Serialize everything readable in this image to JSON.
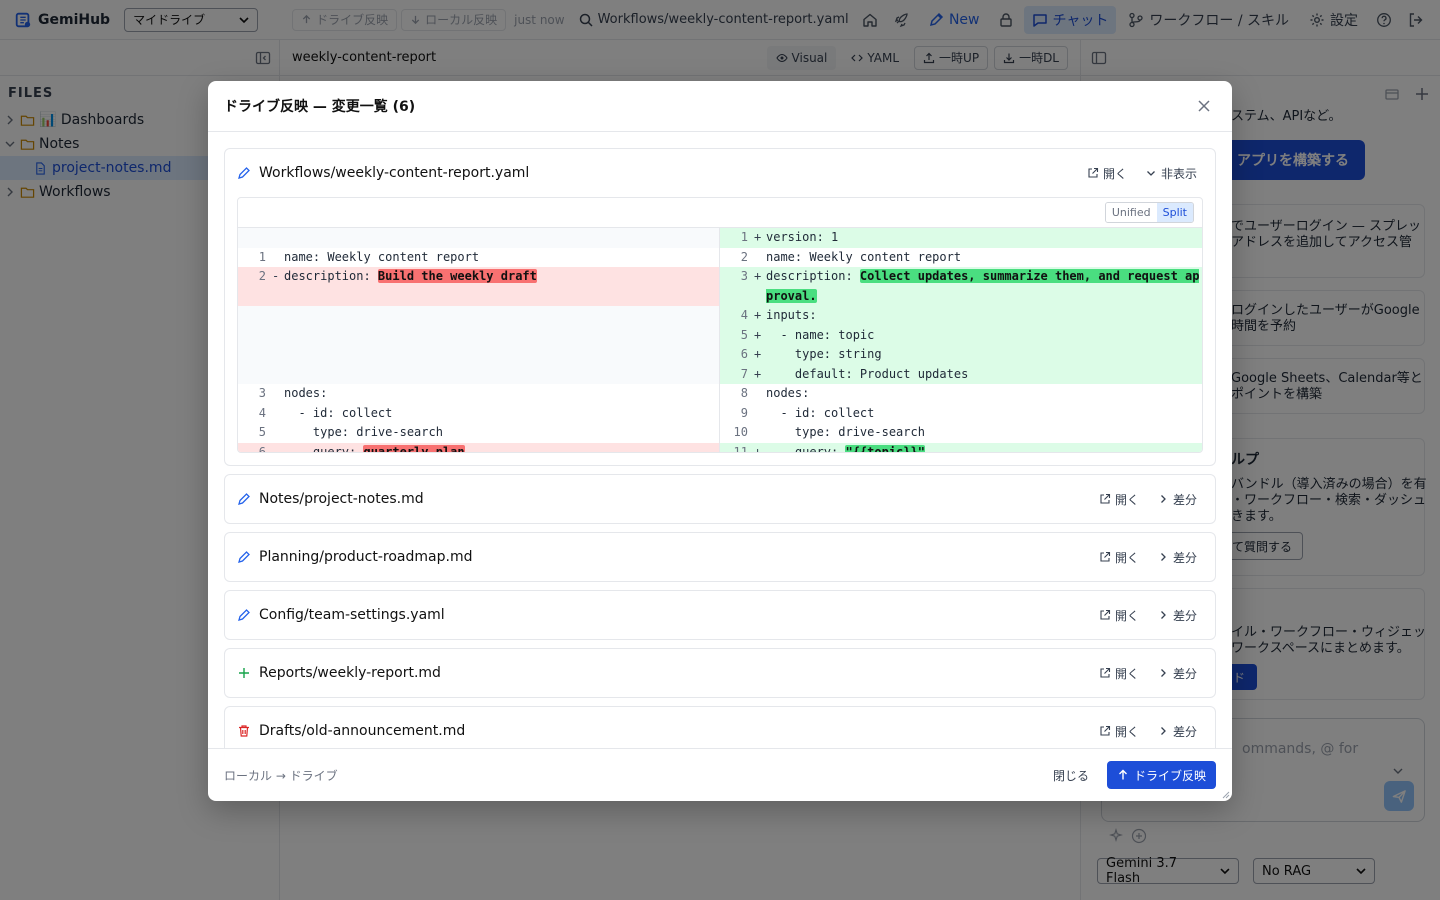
{
  "topbar": {
    "brand": "GemiHub",
    "drive_select": "マイドライブ",
    "push_btn": "ドライブ反映",
    "pull_btn": "ローカル反映",
    "sync_status": "just now",
    "current_path": "Workflows/weekly-content-report.yaml",
    "new_label": "New",
    "chat_label": "チャット",
    "workflow_label": "ワークフロー / スキル",
    "settings_label": "設定"
  },
  "sidebar": {
    "files_label": "FILES",
    "tree": [
      {
        "label": "📊 Dashboards",
        "type": "folder",
        "open": false
      },
      {
        "label": "Notes",
        "type": "folder",
        "open": true
      },
      {
        "label": "project-notes.md",
        "type": "file",
        "selected": true
      },
      {
        "label": "Workflows",
        "type": "folder",
        "open": false
      }
    ]
  },
  "editor": {
    "filename": "weekly-content-report",
    "visual": "Visual",
    "yaml": "YAML",
    "upload": "一時UP",
    "download": "一時DL"
  },
  "chat": {
    "line1": "ステム、APIなど。",
    "primary_btn": "アプリを構築する",
    "card1_l1": "でユーザーログイン — スプレッ",
    "card1_l2": "アドレスを追加してアクセス管",
    "card2_l1": "ログインしたユーザーがGoogle",
    "card2_l2": "時間を予約",
    "card3_l1": "Google Sheets、Calendar等と",
    "card3_l2": "ポイントを構築",
    "help_title": "ルプ",
    "help_l1": "バンドル（導入済みの場合）を有",
    "help_l2": "・ワークフロー・検索・ダッシュ",
    "help_l3": "きます。",
    "help_btn": "て質問する",
    "ws_l1": "イル・ワークフロー・ウィジェッ",
    "ws_l2": "ワークスペースにまとめます。",
    "ws_btn": "ド",
    "input_placeholder": "ommands, @ for",
    "model": "Gemini 3.7 Flash",
    "rag": "No RAG"
  },
  "modal": {
    "title": "ドライブ反映 — 変更一覧 (6)",
    "open_label": "開く",
    "hide_label": "非表示",
    "diff_label": "差分",
    "unified": "Unified",
    "split": "Split",
    "direction": "ローカル → ドライブ",
    "close_btn": "閉じる",
    "apply_btn": "ドライブ反映",
    "files": [
      {
        "path": "Workflows/weekly-content-report.yaml",
        "kind": "modified"
      },
      {
        "path": "Notes/project-notes.md",
        "kind": "modified"
      },
      {
        "path": "Planning/product-roadmap.md",
        "kind": "modified"
      },
      {
        "path": "Config/team-settings.yaml",
        "kind": "modified"
      },
      {
        "path": "Reports/weekly-report.md",
        "kind": "added"
      },
      {
        "path": "Drafts/old-announcement.md",
        "kind": "deleted"
      }
    ],
    "diff": {
      "left": [
        {
          "ln": "",
          "mk": "",
          "text": "",
          "type": "pad"
        },
        {
          "ln": "1",
          "mk": "",
          "text": "name: Weekly content report",
          "type": "ctx"
        },
        {
          "ln": "2",
          "mk": "-",
          "pre": "description: ",
          "hl": "Build the weekly draft",
          "type": "del"
        },
        {
          "ln": "",
          "mk": "",
          "text": "",
          "type": "del"
        },
        {
          "ln": "",
          "mk": "",
          "text": "",
          "type": "pad"
        },
        {
          "ln": "",
          "mk": "",
          "text": "",
          "type": "pad"
        },
        {
          "ln": "",
          "mk": "",
          "text": "",
          "type": "pad"
        },
        {
          "ln": "",
          "mk": "",
          "text": "",
          "type": "pad"
        },
        {
          "ln": "3",
          "mk": "",
          "text": "nodes:",
          "type": "ctx"
        },
        {
          "ln": "4",
          "mk": "",
          "text": "  - id: collect",
          "type": "ctx"
        },
        {
          "ln": "5",
          "mk": "",
          "text": "    type: drive-search",
          "type": "ctx"
        },
        {
          "ln": "6",
          "mk": "-",
          "pre": "    query: ",
          "hl": "quarterly plan",
          "type": "del"
        }
      ],
      "right": [
        {
          "ln": "1",
          "mk": "+",
          "text": "version: 1",
          "type": "add"
        },
        {
          "ln": "2",
          "mk": "",
          "text": "name: Weekly content report",
          "type": "ctx"
        },
        {
          "ln": "3",
          "mk": "+",
          "pre": "description: ",
          "hl": "Collect updates, summarize them, and request approval.",
          "type": "add"
        },
        {
          "ln": "4",
          "mk": "+",
          "text": "inputs:",
          "type": "add"
        },
        {
          "ln": "5",
          "mk": "+",
          "text": "  - name: topic",
          "type": "add"
        },
        {
          "ln": "6",
          "mk": "+",
          "text": "    type: string",
          "type": "add"
        },
        {
          "ln": "7",
          "mk": "+",
          "text": "    default: Product updates",
          "type": "add"
        },
        {
          "ln": "8",
          "mk": "",
          "text": "nodes:",
          "type": "ctx"
        },
        {
          "ln": "9",
          "mk": "",
          "text": "  - id: collect",
          "type": "ctx"
        },
        {
          "ln": "10",
          "mk": "",
          "text": "    type: drive-search",
          "type": "ctx"
        },
        {
          "ln": "11",
          "mk": "+",
          "pre": "    query: ",
          "hl": "\"{{topic}}\"",
          "type": "add"
        }
      ]
    }
  },
  "colors": {
    "accent": "#1d4ed8",
    "modified": "#2563eb",
    "added": "#16a34a",
    "deleted": "#dc2626"
  }
}
